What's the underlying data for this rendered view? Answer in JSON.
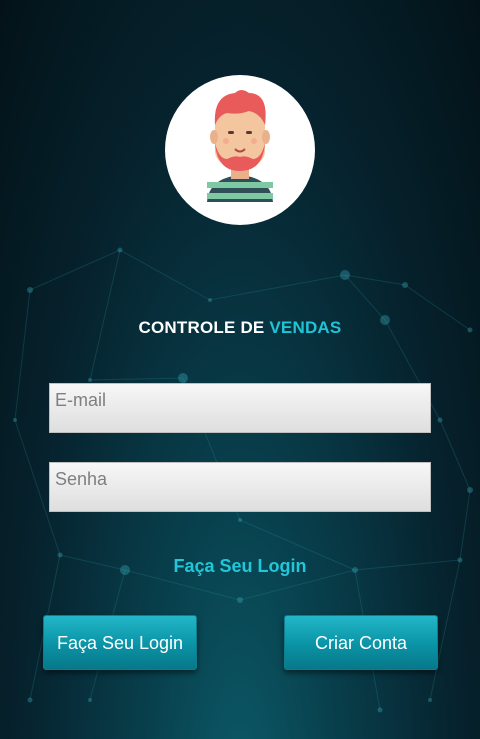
{
  "header": {
    "title_prefix": "CONTROLE DE ",
    "title_accent": "VENDAS"
  },
  "form": {
    "email_placeholder": "E-mail",
    "password_placeholder": "Senha",
    "email_value": "",
    "password_value": ""
  },
  "links": {
    "login_link": "Faça Seu Login"
  },
  "buttons": {
    "login": "Faça Seu Login",
    "create_account": "Criar Conta"
  },
  "avatar": {
    "icon": "user-avatar-icon"
  },
  "colors": {
    "accent": "#20c4d6",
    "background_dark": "#031218",
    "button": "#0b92a5"
  }
}
